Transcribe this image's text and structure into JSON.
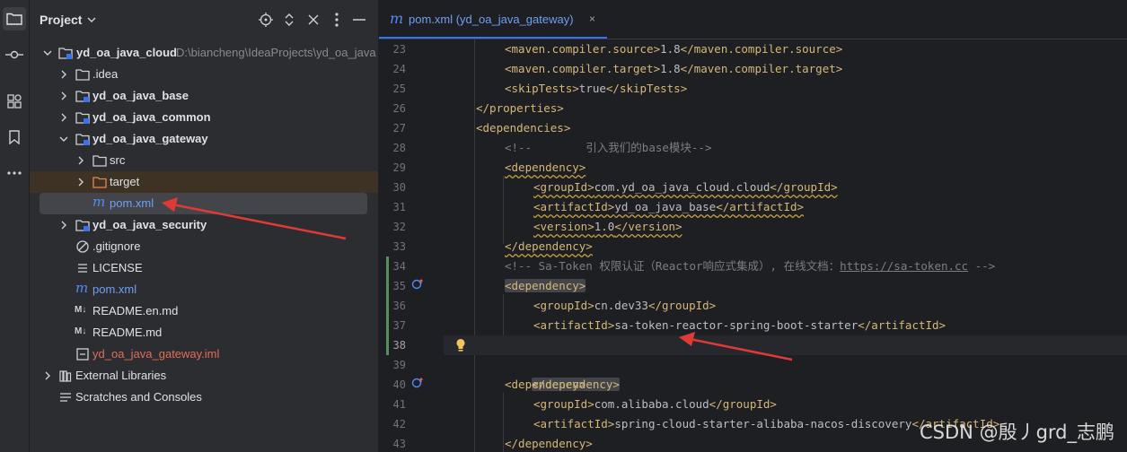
{
  "project_panel": {
    "title": "Project",
    "tree": [
      {
        "label": "yd_oa_java_cloud",
        "path": "D:\\biancheng\\IdeaProjects\\yd_oa_java",
        "bold": true
      },
      {
        "label": ".idea"
      },
      {
        "label": "yd_oa_java_base",
        "bold": true
      },
      {
        "label": "yd_oa_java_common",
        "bold": true
      },
      {
        "label": "yd_oa_java_gateway",
        "bold": true
      },
      {
        "label": "src"
      },
      {
        "label": "target"
      },
      {
        "label": "pom.xml"
      },
      {
        "label": "yd_oa_java_security",
        "bold": true
      },
      {
        "label": ".gitignore"
      },
      {
        "label": "LICENSE"
      },
      {
        "label": "pom.xml"
      },
      {
        "label": "README.en.md"
      },
      {
        "label": "README.md"
      },
      {
        "label": "yd_oa_java_gateway.iml"
      },
      {
        "label": "External Libraries"
      },
      {
        "label": "Scratches and Consoles"
      }
    ]
  },
  "editor": {
    "tab_label": "pom.xml (yd_oa_java_gateway)",
    "tab_close": "×",
    "line_numbers": [
      "23",
      "24",
      "25",
      "26",
      "27",
      "28",
      "29",
      "30",
      "31",
      "32",
      "33",
      "34",
      "35",
      "36",
      "37",
      "38",
      "39",
      "40",
      "41",
      "42",
      "43"
    ],
    "lines": {
      "l23": {
        "tag_open": "<maven.compiler.source>",
        "value": "1.8",
        "tag_close": "</maven.compiler.source>"
      },
      "l24": {
        "tag_open": "<maven.compiler.target>",
        "value": "1.8",
        "tag_close": "</maven.compiler.target>"
      },
      "l25": {
        "tag_open": "<skipTests>",
        "value": "true",
        "tag_close": "</skipTests>"
      },
      "l26": {
        "tag": "</properties>"
      },
      "l27": {
        "tag": "<dependencies>"
      },
      "l28": {
        "comment": "<!--        引入我们的base模块-->"
      },
      "l29": {
        "tag": "<dependency>"
      },
      "l30": {
        "tag_open": "<groupId>",
        "value": "com.yd_oa_java_cloud.cloud",
        "tag_close": "</groupId>"
      },
      "l31": {
        "tag_open": "<artifactId>",
        "value": "yd_oa_java_base",
        "tag_close": "</artifactId>"
      },
      "l32": {
        "tag_open": "<version>",
        "value": "1.0",
        "tag_close": "</version>"
      },
      "l33": {
        "tag": "</dependency>"
      },
      "l34": {
        "comment_start": "<!-- Sa-Token 权限认证（Reactor响应式集成）, 在线文档：",
        "link": "https://sa-token.cc",
        "comment_end": " -->"
      },
      "l35": {
        "tag": "<dependency>"
      },
      "l36": {
        "tag_open": "<groupId>",
        "value": "cn.dev33",
        "tag_close": "</groupId>"
      },
      "l37": {
        "tag_open": "<artifactId>",
        "value": "sa-token-reactor-spring-boot-starter",
        "tag_close": "</artifactId>"
      },
      "l38": {
        "tag": "</dependency>"
      },
      "l40": {
        "tag": "<dependency>"
      },
      "l41": {
        "tag_open": "<groupId>",
        "value": "com.alibaba.cloud",
        "tag_close": "</groupId>"
      },
      "l42": {
        "tag_open": "<artifactId>",
        "value": "spring-cloud-starter-alibaba-nacos-discovery",
        "tag_close": "</artifactId>"
      },
      "l43": {
        "tag": "</dependency>"
      }
    }
  },
  "watermark": "CSDN @殷丿grd_志鹏",
  "colors": {
    "background": "#1e1f22",
    "panel": "#2b2d30",
    "accent": "#3574f0",
    "xml_tag": "#d5b778",
    "annotation_arrow": "#e03a36"
  }
}
